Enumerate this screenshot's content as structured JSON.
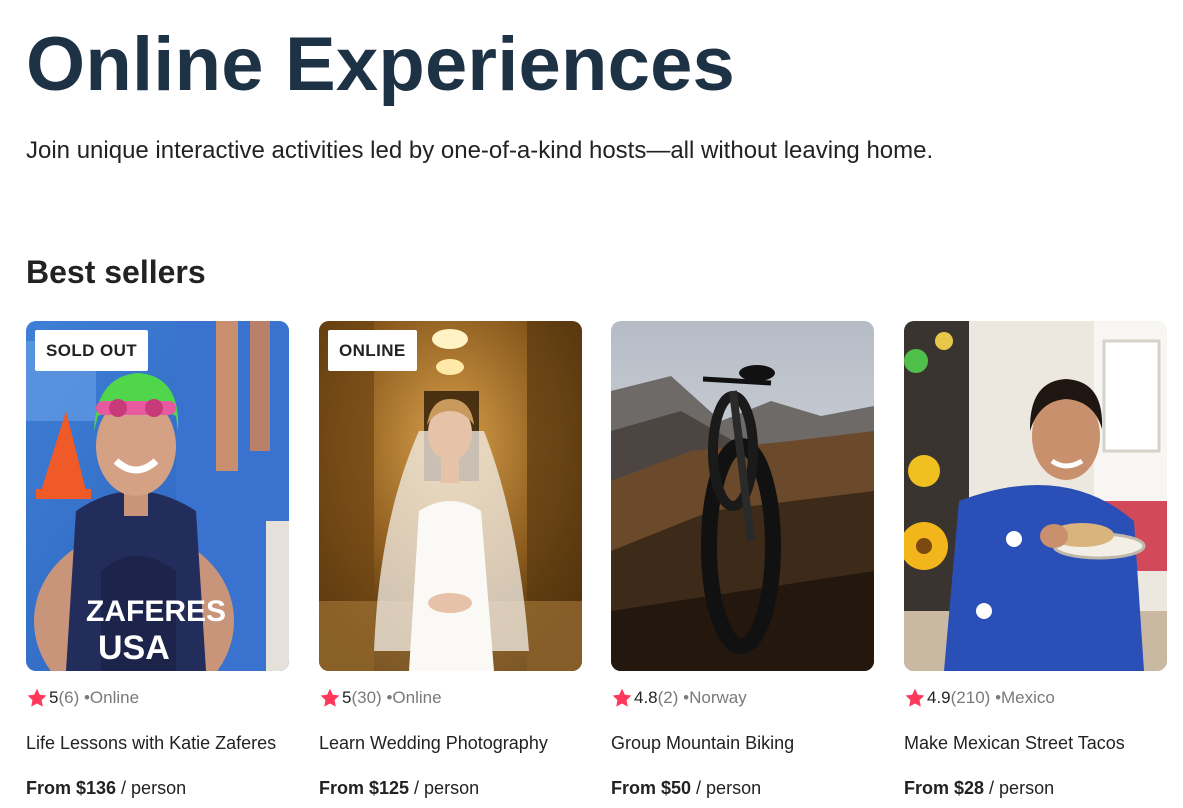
{
  "header": {
    "title": "Online Experiences",
    "subtitle": "Join unique interactive activities led by one-of-a-kind hosts—all without leaving home."
  },
  "best_sellers": {
    "title": "Best sellers",
    "star_color": "#ff385c",
    "cards": [
      {
        "badge": "SOLD OUT",
        "rating": "5",
        "reviews": "(6)",
        "location": "•Online",
        "title": "Life Lessons with Katie Zaferes",
        "price": "From $136",
        "price_unit": " / person",
        "image": "triathlete-photo"
      },
      {
        "badge": "ONLINE",
        "rating": "5",
        "reviews": "(30)",
        "location": "•Online",
        "title": "Learn Wedding Photography",
        "price": "From $125",
        "price_unit": " / person",
        "image": "bride-photo"
      },
      {
        "badge": "",
        "rating": "4.8",
        "reviews": "(2)",
        "location": "•Norway",
        "title": "Group Mountain Biking",
        "price": "From $50",
        "price_unit": " / person",
        "image": "mountain-bike-photo"
      },
      {
        "badge": "",
        "rating": "4.9",
        "reviews": "(210)",
        "location": "•Mexico",
        "title": "Make Mexican Street Tacos",
        "price": "From $28",
        "price_unit": " / person",
        "image": "tacos-chef-photo"
      }
    ]
  }
}
